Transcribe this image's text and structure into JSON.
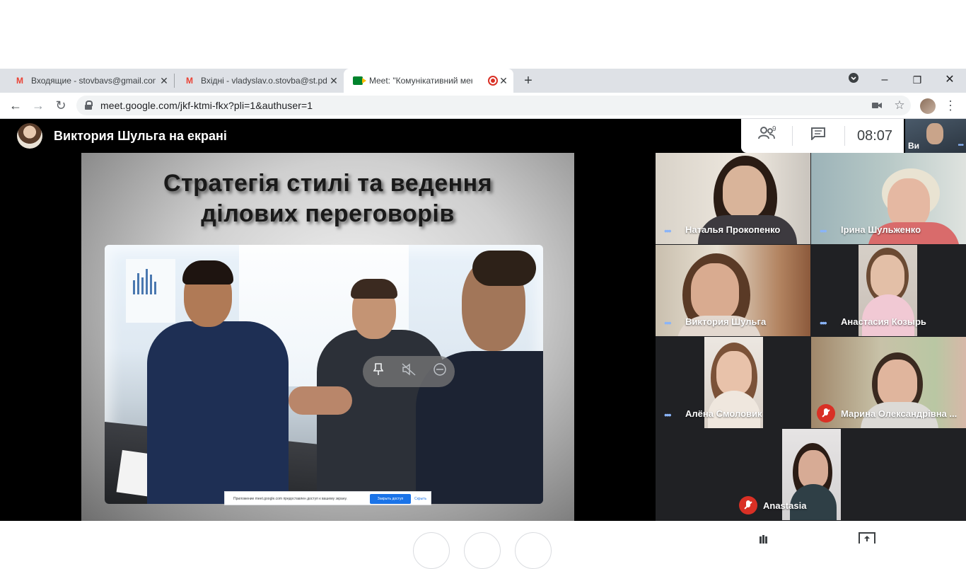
{
  "browser": {
    "tabs": [
      {
        "title": "Входящие - stovbavs@gmail.com",
        "favicon": "gmail-icon",
        "active": false
      },
      {
        "title": "Вхідні - vladyslav.o.stovba@st.pdpu.edu.ua",
        "favicon": "gmail-icon",
        "active": false
      },
      {
        "title": "Meet: \"Комунікативний менеджмент\"",
        "favicon": "meet-icon",
        "active": true,
        "recording": true
      }
    ],
    "new_tab": "+",
    "url": "meet.google.com/jkf-ktmi-fkx?pli=1&authuser=1",
    "window_controls": {
      "minimize": "–",
      "maximize": "❐",
      "close": "✕"
    }
  },
  "meet": {
    "header_title": "Виктория Шульга на екрані",
    "people_count": "9",
    "clock": "08:07",
    "self_label": "Ви",
    "slide": {
      "title_line1": "Стратегія стилі та ведення",
      "title_line2": "ділових переговорів"
    },
    "share_banner": {
      "text": "Приложение meet.google.com предоставлен доступ к вашему экрану.",
      "stop_label": "Закрыть доступ",
      "hide_label": "Скрыть"
    },
    "participants": [
      {
        "name": "Наталья Прокопенко",
        "muted": false
      },
      {
        "name": "Ірина Шульженко",
        "muted": false
      },
      {
        "name": "Виктория Шульга",
        "muted": false
      },
      {
        "name": "Анастасия Козырь",
        "muted": false
      },
      {
        "name": "Алёна Смоловик",
        "muted": false
      },
      {
        "name": "Марина Олександрівна ...",
        "muted": true
      },
      {
        "name": "Anastasia",
        "muted": true
      }
    ]
  },
  "colors": {
    "meet_bg": "#202124",
    "accent": "#1a73e8",
    "muted_red": "#d93025",
    "speaking_dots": "#8ab4f8"
  }
}
